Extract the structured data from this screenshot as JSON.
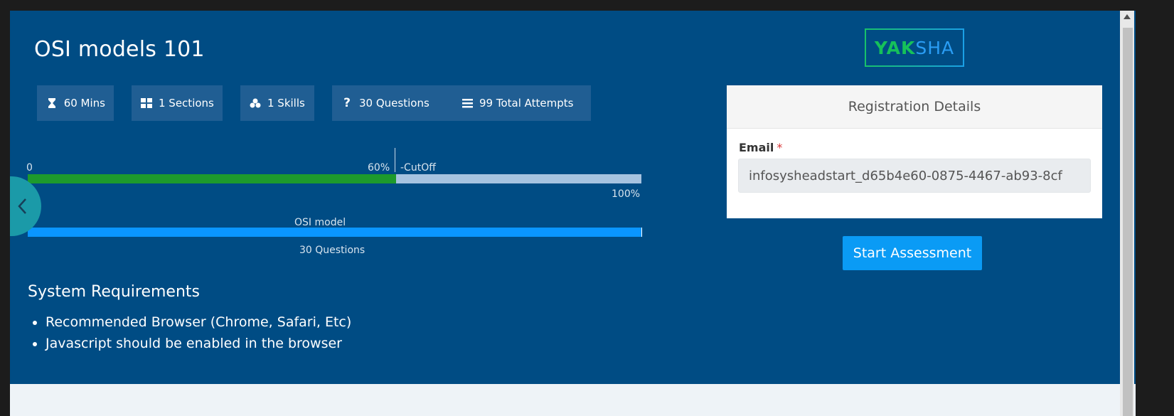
{
  "page": {
    "title": "OSI models 101"
  },
  "stats": [
    {
      "icon": "hourglass-icon",
      "label": "60 Mins"
    },
    {
      "icon": "grid-icon",
      "label": "1 Sections"
    },
    {
      "icon": "cubes-icon",
      "label": "1 Skills"
    },
    {
      "icon": "question-icon",
      "label": "30 Questions"
    },
    {
      "icon": "list-icon",
      "label": "99 Total Attempts"
    }
  ],
  "score_bar": {
    "min_label": "0",
    "cutoff_label": "60%",
    "cutoff_text": "-CutOff",
    "max_label": "100%",
    "cutoff_fraction": 0.6
  },
  "section": {
    "name": "OSI model",
    "questions_label": "30 Questions"
  },
  "requirements": {
    "title": "System Requirements",
    "items": [
      "Recommended Browser (Chrome, Safari, Etc)",
      "Javascript should be enabled in the browser"
    ]
  },
  "logo": {
    "part_a": "YAK",
    "part_b": "SHA"
  },
  "registration": {
    "header": "Registration Details",
    "email_label": "Email",
    "required_mark": "*",
    "email_value": "infosysheadstart_d65b4e60-0875-4467-ab93-8cf"
  },
  "actions": {
    "start_label": "Start Assessment"
  },
  "colors": {
    "hero_bg": "#004c84",
    "chip_bg": "#205e93",
    "pass_fill": "#1d9a2c",
    "bar_track": "#a6c3e0",
    "section_bar": "#0a96ff",
    "primary_button": "#0a9bf5"
  }
}
